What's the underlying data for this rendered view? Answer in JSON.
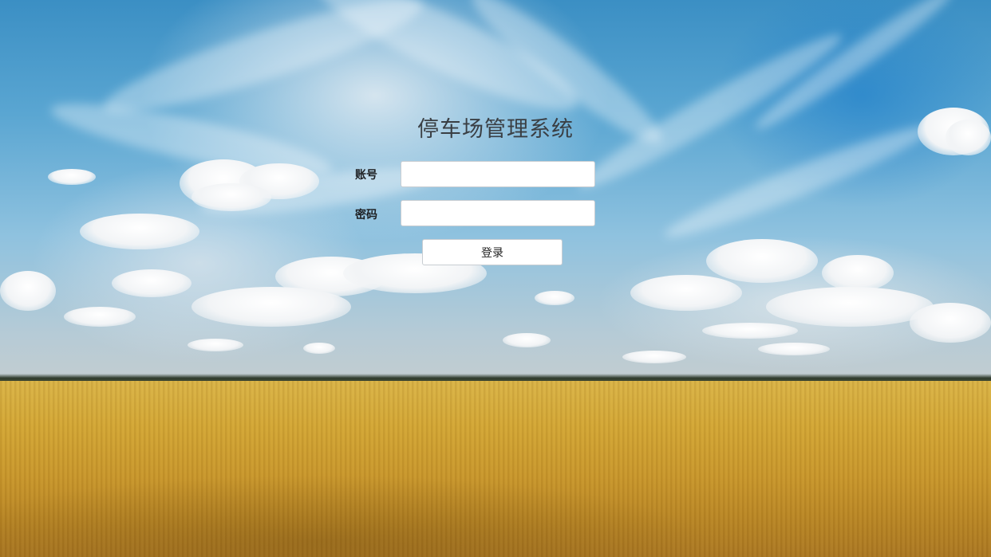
{
  "app": {
    "title": "停车场管理系统"
  },
  "login_form": {
    "account_label": "账号",
    "account_value": "",
    "password_label": "密码",
    "password_value": "",
    "submit_label": "登录"
  },
  "colors": {
    "title_text": "#3a3f44",
    "input_background": "#ffffff",
    "sky": "#5aa6d2",
    "field": "#d2a635"
  }
}
